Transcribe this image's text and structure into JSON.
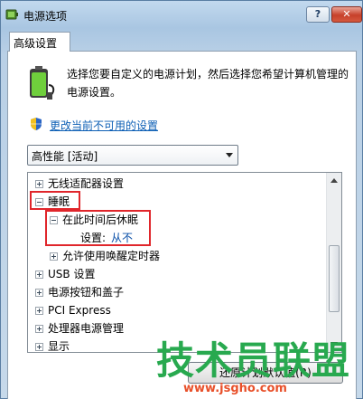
{
  "window": {
    "title": "电源选项",
    "help_label": "?",
    "close_label": "✕"
  },
  "tab": {
    "label": "高级设置"
  },
  "description": "选择您要自定义的电源计划，然后选择您希望计算机管理的电源设置。",
  "change_link": "更改当前不可用的设置",
  "plan_select": {
    "value": "高性能 [活动]"
  },
  "tree": {
    "items": [
      {
        "label": "无线适配器设置",
        "expanded": false
      },
      {
        "label": "睡眠",
        "expanded": true
      },
      {
        "label": "在此时间后休眠",
        "expanded": true
      },
      {
        "label": "设置:",
        "value": "从不"
      },
      {
        "label": "允许使用唤醒定时器",
        "expanded": false
      },
      {
        "label": "USB 设置",
        "expanded": false
      },
      {
        "label": "电源按钮和盖子",
        "expanded": false
      },
      {
        "label": "PCI Express",
        "expanded": false
      },
      {
        "label": "处理器电源管理",
        "expanded": false
      },
      {
        "label": "显示",
        "expanded": false
      }
    ]
  },
  "restore_button": "还原计划默认值(R)",
  "watermark": {
    "title": "技术员联盟",
    "url": "www.jsgho.com"
  },
  "colors": {
    "link": "#0d5fb5",
    "highlight": "#e0262b",
    "watermark_green": "#28a94f",
    "watermark_orange": "#e8502a"
  }
}
